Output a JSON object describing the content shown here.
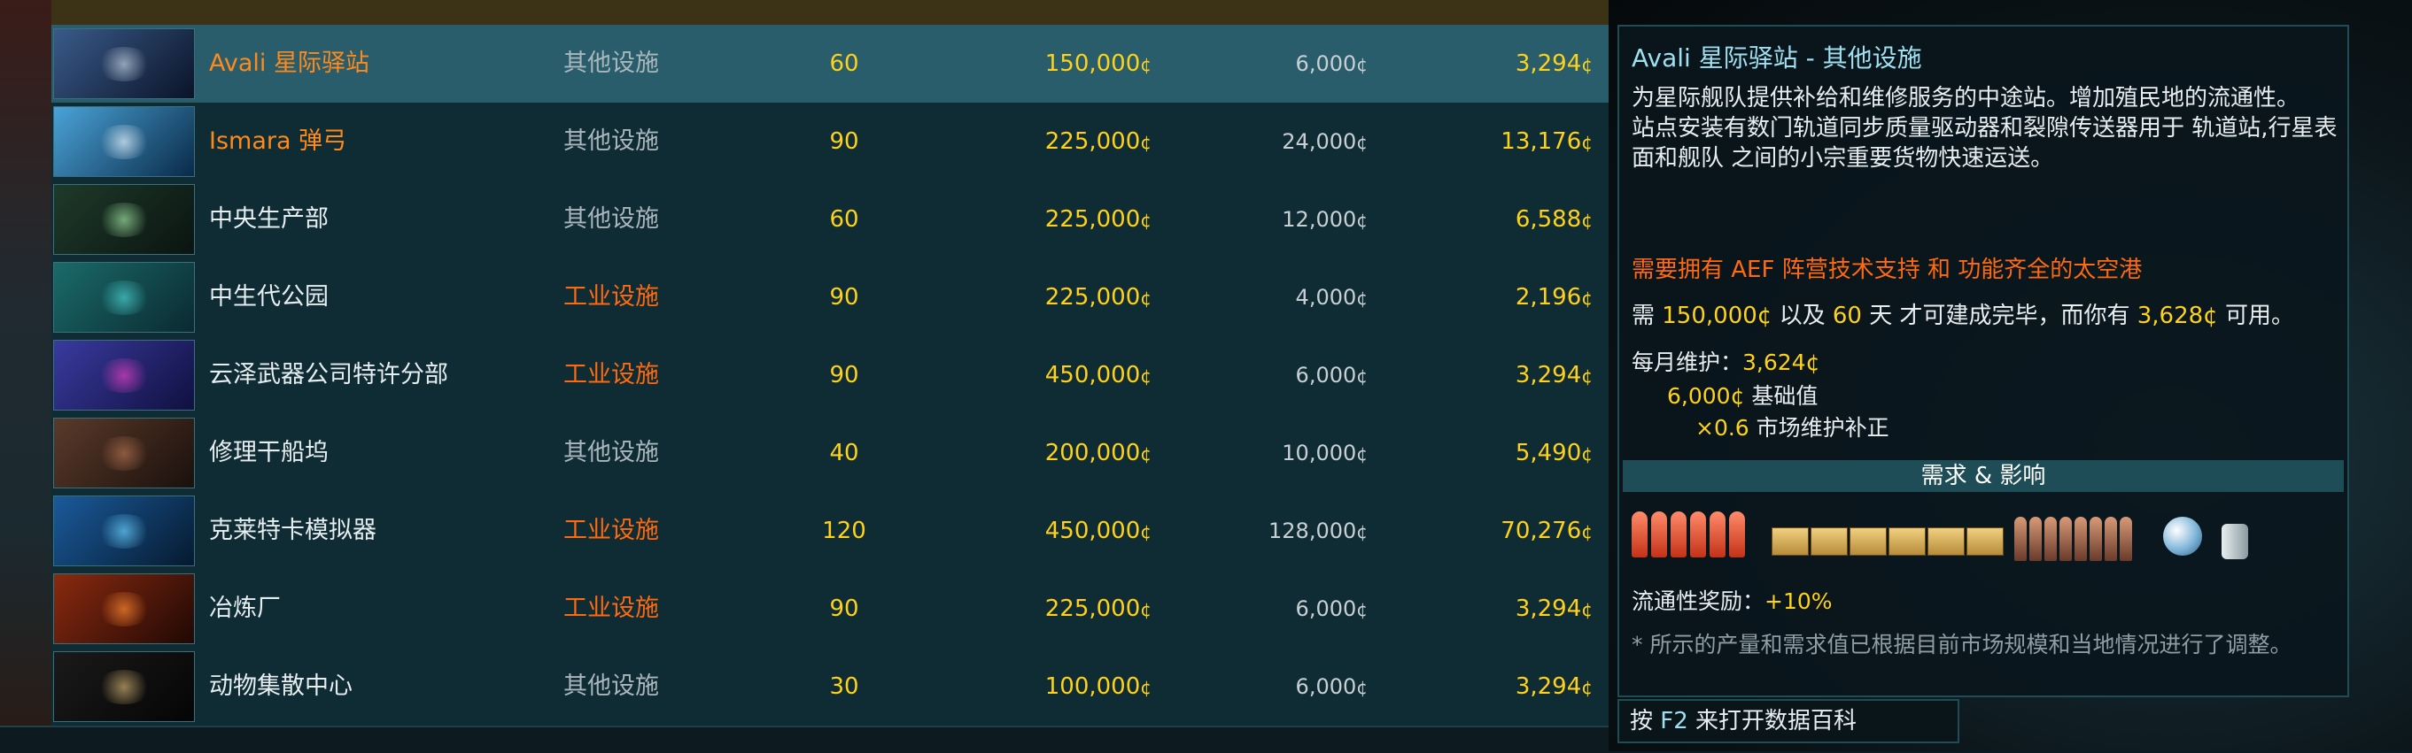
{
  "rows": [
    {
      "name": "Avali 星际驿站",
      "category": "其他设施",
      "category_highlight": false,
      "name_highlight": true,
      "time": "60",
      "cost": "150,000",
      "upkeep": "6,000",
      "income": "3,294",
      "selected": true,
      "thumb_colors": [
        "#3a5a8a",
        "#0a1428",
        "#c0d0e0"
      ]
    },
    {
      "name": "Ismara 弹弓",
      "category": "其他设施",
      "category_highlight": false,
      "name_highlight": true,
      "time": "90",
      "cost": "225,000",
      "upkeep": "24,000",
      "income": "13,176",
      "selected": false,
      "thumb_colors": [
        "#4aa3d8",
        "#0a2a48",
        "#e8f4ff"
      ]
    },
    {
      "name": "中央生产部",
      "category": "其他设施",
      "category_highlight": false,
      "name_highlight": false,
      "time": "60",
      "cost": "225,000",
      "upkeep": "12,000",
      "income": "6,588",
      "selected": false,
      "thumb_colors": [
        "#1f3a2a",
        "#0a1410",
        "#9fe0a0"
      ]
    },
    {
      "name": "中生代公园",
      "category": "工业设施",
      "category_highlight": true,
      "name_highlight": false,
      "time": "90",
      "cost": "225,000",
      "upkeep": "4,000",
      "income": "2,196",
      "selected": false,
      "thumb_colors": [
        "#1a6a6a",
        "#0a2a30",
        "#4ad0d0"
      ]
    },
    {
      "name": "云泽武器公司特许分部",
      "category": "工业设施",
      "category_highlight": true,
      "name_highlight": false,
      "time": "90",
      "cost": "450,000",
      "upkeep": "6,000",
      "income": "3,294",
      "selected": false,
      "thumb_colors": [
        "#3a3aa0",
        "#101040",
        "#e040c0"
      ]
    },
    {
      "name": "修理干船坞",
      "category": "其他设施",
      "category_highlight": false,
      "name_highlight": false,
      "time": "40",
      "cost": "200,000",
      "upkeep": "10,000",
      "income": "5,490",
      "selected": false,
      "thumb_colors": [
        "#5a3a2a",
        "#1a100c",
        "#b07050"
      ]
    },
    {
      "name": "克莱特卡模拟器",
      "category": "工业设施",
      "category_highlight": true,
      "name_highlight": false,
      "time": "120",
      "cost": "450,000",
      "upkeep": "128,000",
      "income": "70,276",
      "selected": false,
      "thumb_colors": [
        "#1a5a9a",
        "#061a30",
        "#6ad0ff"
      ]
    },
    {
      "name": "冶炼厂",
      "category": "工业设施",
      "category_highlight": true,
      "name_highlight": false,
      "time": "90",
      "cost": "225,000",
      "upkeep": "6,000",
      "income": "3,294",
      "selected": false,
      "thumb_colors": [
        "#8a2a10",
        "#200804",
        "#ff8a30"
      ]
    },
    {
      "name": "动物集散中心",
      "category": "其他设施",
      "category_highlight": false,
      "name_highlight": false,
      "time": "30",
      "cost": "100,000",
      "upkeep": "6,000",
      "income": "3,294",
      "selected": false,
      "thumb_colors": [
        "#1a1a1a",
        "#050505",
        "#d0b070"
      ]
    }
  ],
  "currency_symbol": "¢",
  "panel": {
    "title_name": "Avali 星际驿站",
    "title_sep": " - ",
    "title_category": "其他设施",
    "description": "为星际舰队提供补给和维修服务的中途站。增加殖民地的流通性。\n站点安装有数门轨道同步质量驱动器和裂隙传送器用于 轨道站,行星表面和舰队 之间的小宗重要货物快速运送。",
    "requirement": "需要拥有 AEF 阵营技术支持 和 功能齐全的太空港",
    "build_pre": "需 ",
    "build_cost": "150,000¢",
    "build_mid1": " 以及 ",
    "build_days": "60",
    "build_mid2": " 天 才可建成完毕，而你有 ",
    "build_have": "3,628¢",
    "build_post": " 可用。",
    "upkeep_label": "每月维护：",
    "upkeep_value": "3,624¢",
    "base_value": "6,000¢",
    "base_label": " 基础值",
    "mult_value": "×0.6",
    "mult_label": " 市场维护补正",
    "demand_header": "需求 & 影响",
    "bonus_label": "流通性奖励：",
    "bonus_value": "+10%",
    "footnote": "* 所示的产量和需求值已根据目前市场规模和当地情况进行了调整。",
    "f2_pre": "按 ",
    "f2_key": "F2",
    "f2_post": " 来打开数据百科"
  },
  "icons": [
    "rocket-icon",
    "crate-icon",
    "worker-icon",
    "orb-icon",
    "cans-icon"
  ]
}
